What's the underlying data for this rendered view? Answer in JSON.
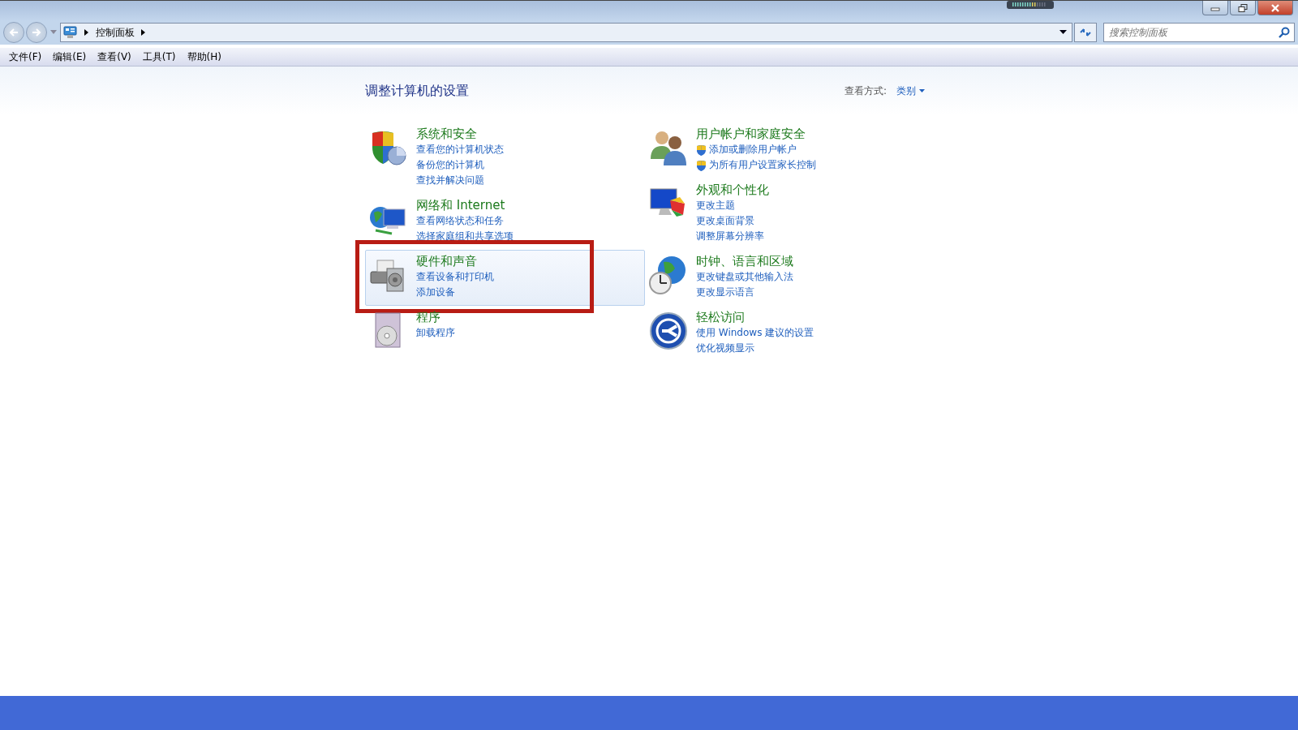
{
  "window": {
    "controls": [
      {
        "kind": "minimize"
      },
      {
        "kind": "restore"
      },
      {
        "kind": "close"
      }
    ]
  },
  "address_bar": {
    "breadcrumb": "控制面板"
  },
  "search": {
    "placeholder": "搜索控制面板"
  },
  "menu": [
    "文件(F)",
    "编辑(E)",
    "查看(V)",
    "工具(T)",
    "帮助(H)"
  ],
  "heading": "调整计算机的设置",
  "view_by": {
    "label": "查看方式:",
    "value": "类别"
  },
  "columns": [
    {
      "categories": [
        {
          "kind": "security",
          "title": "系统和安全",
          "selected": false,
          "annotated": false,
          "links": [
            {
              "text": "查看您的计算机状态",
              "shield": false
            },
            {
              "text": "备份您的计算机",
              "shield": false
            },
            {
              "text": "查找并解决问题",
              "shield": false
            }
          ]
        },
        {
          "kind": "network",
          "title": "网络和 Internet",
          "selected": false,
          "annotated": false,
          "links": [
            {
              "text": "查看网络状态和任务",
              "shield": false
            },
            {
              "text": "选择家庭组和共享选项",
              "shield": false
            }
          ]
        },
        {
          "kind": "hardware",
          "title": "硬件和声音",
          "selected": true,
          "annotated": true,
          "links": [
            {
              "text": "查看设备和打印机",
              "shield": false
            },
            {
              "text": "添加设备",
              "shield": false
            }
          ]
        },
        {
          "kind": "programs",
          "title": "程序",
          "selected": false,
          "annotated": false,
          "links": [
            {
              "text": "卸载程序",
              "shield": false
            }
          ]
        }
      ]
    },
    {
      "categories": [
        {
          "kind": "users",
          "title": "用户帐户和家庭安全",
          "selected": false,
          "annotated": false,
          "links": [
            {
              "text": "添加或删除用户帐户",
              "shield": true
            },
            {
              "text": "为所有用户设置家长控制",
              "shield": true
            }
          ]
        },
        {
          "kind": "appearance",
          "title": "外观和个性化",
          "selected": false,
          "annotated": false,
          "links": [
            {
              "text": "更改主题",
              "shield": false
            },
            {
              "text": "更改桌面背景",
              "shield": false
            },
            {
              "text": "调整屏幕分辨率",
              "shield": false
            }
          ]
        },
        {
          "kind": "clock",
          "title": "时钟、语言和区域",
          "selected": false,
          "annotated": false,
          "links": [
            {
              "text": "更改键盘或其他输入法",
              "shield": false
            },
            {
              "text": "更改显示语言",
              "shield": false
            }
          ]
        },
        {
          "kind": "access",
          "title": "轻松访问",
          "selected": false,
          "annotated": false,
          "links": [
            {
              "text": "使用 Windows 建议的设置",
              "shield": false
            },
            {
              "text": "优化视频显示",
              "shield": false
            }
          ]
        }
      ]
    }
  ]
}
